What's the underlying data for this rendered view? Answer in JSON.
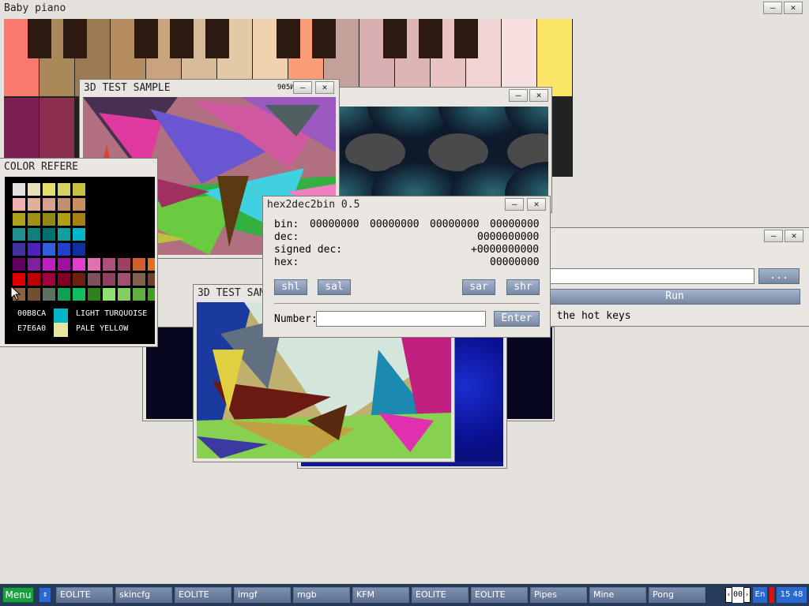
{
  "windows": {
    "piano": {
      "title": "Baby piano",
      "key_colors": [
        "#fb7a70",
        "#ab8858",
        "#9a7a52",
        "#b68d60",
        "#c9a27e",
        "#d7ba97",
        "#e4c9a7",
        "#efd1ae",
        "#fb9d78",
        "#c4a09a",
        "#d8aeb0",
        "#ddb6b4",
        "#e9c3c1",
        "#f2d3d3",
        "#f8dfe0",
        "#fbe566"
      ],
      "lower_key_colors": [
        "#7a1e54",
        "#8c2f4e"
      ],
      "extra_key_color": "#fb7a70"
    },
    "test3d_a": {
      "title": "3D TEST SAMPLE",
      "extra_glyph": "905И"
    },
    "test3d_b": {
      "title": "3D TEST SAM"
    },
    "pattern_win": {
      "title": ""
    },
    "color_ref": {
      "title": "COLOR REFERE",
      "grid_colors": [
        [
          "#e0e0e0",
          "#e8e0b8",
          "#e4e070",
          "#d8d060",
          "#c8c040"
        ],
        [
          "#f0b0b0",
          "#e0b098",
          "#d8a090",
          "#c09070",
          "#c89060"
        ],
        [
          "#b0a020",
          "#a09018",
          "#908810",
          "#b0a010",
          "#a88010"
        ],
        [
          "#209090",
          "#108080",
          "#007070",
          "#10a0a0",
          "#00b8c8"
        ],
        [
          "#4030a0",
          "#5020c0",
          "#3060e0",
          "#2040d0",
          "#1030a0"
        ],
        [
          "#600060",
          "#8020a0",
          "#c020c0",
          "#a010a0",
          "#e040d0",
          "#e070b0",
          "#b05080",
          "#a04060",
          "#d06030",
          "#e07020"
        ],
        [
          "#e00000",
          "#c00000",
          "#a00040",
          "#800020",
          "#702010",
          "#805060",
          "#904060",
          "#a05070",
          "#806050",
          "#704030"
        ],
        [
          "#906040",
          "#705030",
          "#607060",
          "#10a050",
          "#10c060",
          "#308020",
          "#90e070",
          "#80d060",
          "#60b040",
          "#40a020"
        ]
      ],
      "legend": [
        {
          "code": "00B8CA",
          "name": "LIGHT TURQUOISE",
          "color": "#00b8ca"
        },
        {
          "code": "E7E6A0",
          "name": "PALE YELLOW",
          "color": "#e7e6a0"
        }
      ]
    },
    "runner": {
      "path_value": "",
      "browse_label": "...",
      "run_label": "Run",
      "hint_text": "t the hot keys"
    },
    "hex2dec2bin": {
      "title": "hex2dec2bin 0.5",
      "bin_label": "bin:",
      "bin_groups": [
        "00000000",
        "00000000",
        "00000000",
        "00000000"
      ],
      "dec_label": "dec:",
      "dec_value": "0000000000",
      "signed_label": "signed dec:",
      "signed_value": "+0000000000",
      "hex_label": "hex:",
      "hex_value": "00000000",
      "shl": "shl",
      "sal": "sal",
      "sar": "sar",
      "shr": "shr",
      "number_label": "Number:",
      "number_value": "",
      "enter_label": "Enter"
    }
  },
  "taskbar": {
    "menu_label": "Menu",
    "items": [
      "EOLITE",
      "skincfg",
      "EOLITE",
      "imgf",
      "mgb",
      "KFM",
      "EOLITE",
      "EOLITE",
      "Pipes",
      "Mine",
      "Pong"
    ],
    "layout_num": "00",
    "lang": "En",
    "clock": "15 48"
  }
}
